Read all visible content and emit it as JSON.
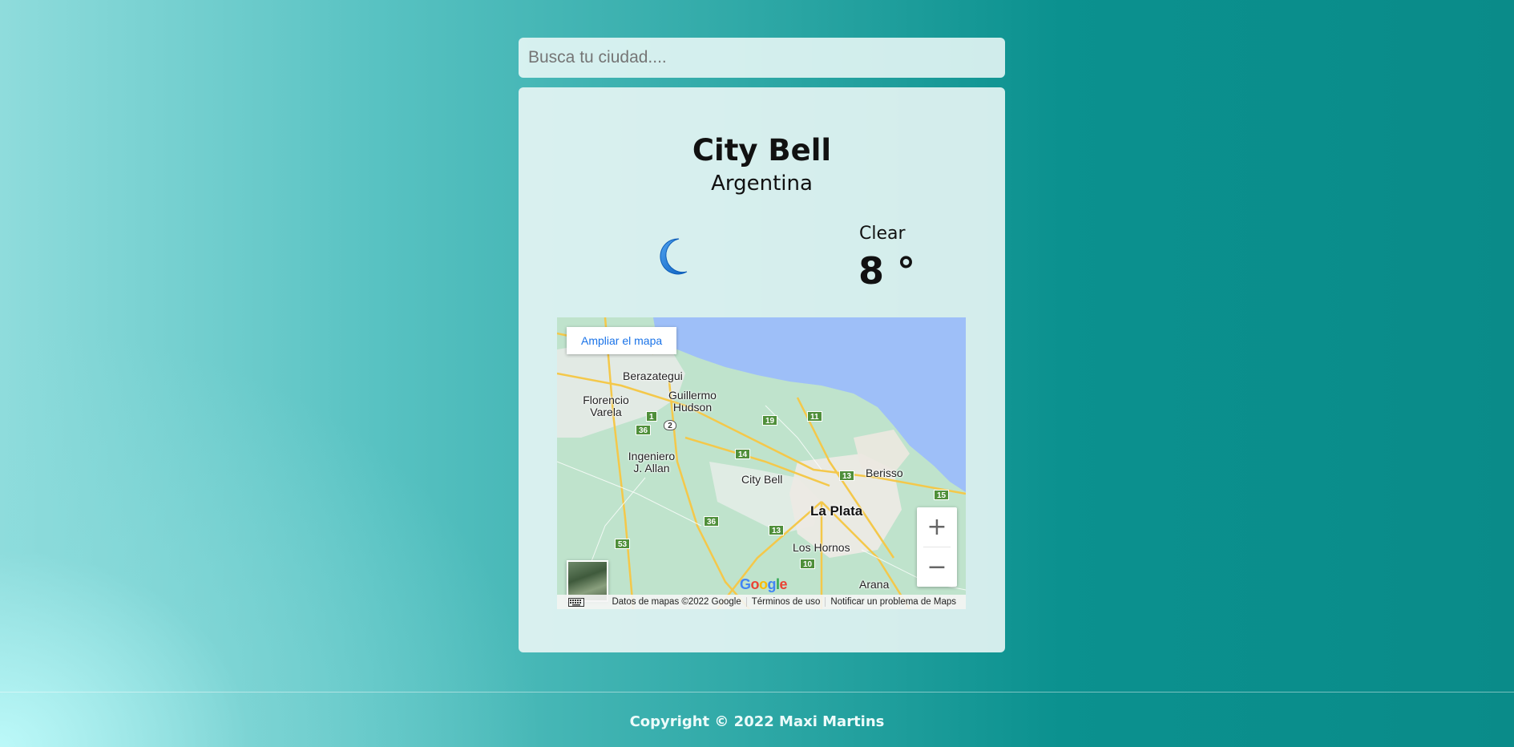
{
  "search": {
    "placeholder": "Busca tu ciudad....",
    "value": ""
  },
  "weather": {
    "city": "City Bell",
    "country": "Argentina",
    "condition": "Clear",
    "temperature": "8 °",
    "icon": "moon-icon"
  },
  "map": {
    "expand_label": "Ampliar el mapa",
    "places": {
      "berazategui": "Berazategui",
      "florencio_varela": "Florencio Varela",
      "guillermo_hudson": "Guillermo Hudson",
      "ingeniero_allan": "Ingeniero J. Allan",
      "city_bell": "City Bell",
      "berisso": "Berisso",
      "la_plata": "La Plata",
      "los_hornos": "Los Hornos",
      "arana": "Arana"
    },
    "routes": [
      "1",
      "2",
      "36",
      "19",
      "11",
      "14",
      "13",
      "15",
      "36",
      "13",
      "53",
      "10"
    ],
    "zoom_in": "+",
    "zoom_out": "−",
    "google_logo": "Google",
    "attribution": {
      "data": "Datos de mapas ©2022 Google",
      "terms": "Términos de uso",
      "report": "Notificar un problema de Maps"
    },
    "colors": {
      "water": "#9ebff8",
      "land": "#bfe3cc",
      "urban": "#e9ecef",
      "road": "#f4c84a"
    }
  },
  "footer": {
    "copyright": "Copyright © 2022 Maxi Martins"
  }
}
